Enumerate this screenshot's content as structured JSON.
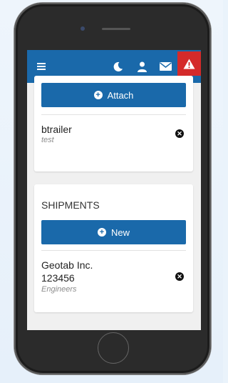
{
  "navbar": {
    "menu_icon": "hamburger-icon",
    "icons": [
      "moon-icon",
      "user-icon",
      "envelope-icon",
      "warning-icon"
    ],
    "accent_color": "#1a69aa",
    "alert_color": "#d42a2a"
  },
  "attach_card": {
    "button_label": "Attach",
    "items": [
      {
        "name": "btrailer",
        "subtitle": "test"
      }
    ]
  },
  "shipments_card": {
    "title": "SHIPMENTS",
    "button_label": "New",
    "items": [
      {
        "name": "Geotab Inc.",
        "number": "123456",
        "subtitle": "Engineers"
      }
    ]
  }
}
